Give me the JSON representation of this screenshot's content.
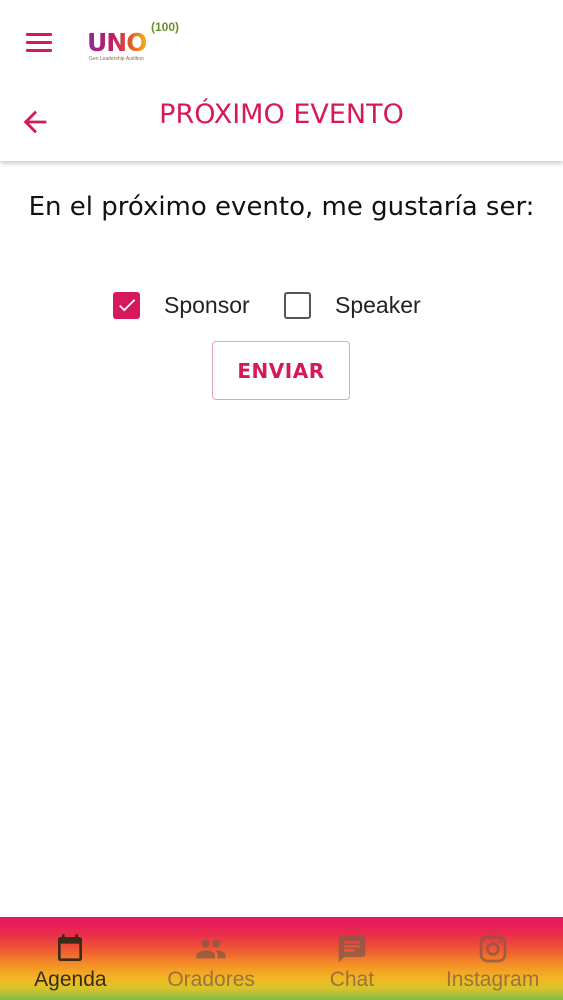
{
  "app": {
    "logo_text": "UNO",
    "logo_superscript": "(100)",
    "logo_tagline": "Geo Leadership Audition"
  },
  "header": {
    "title": "PRÓXIMO EVENTO"
  },
  "form": {
    "question": "En el próximo evento, me gustaría ser:",
    "options": [
      {
        "label": "Sponsor",
        "checked": true
      },
      {
        "label": "Speaker",
        "checked": false
      }
    ],
    "submit_label": "ENVIAR"
  },
  "bottom_nav": {
    "items": [
      {
        "label": "Agenda",
        "icon": "calendar-icon",
        "active": true
      },
      {
        "label": "Oradores",
        "icon": "people-icon",
        "active": false
      },
      {
        "label": "Chat",
        "icon": "chat-icon",
        "active": false
      },
      {
        "label": "Instagram",
        "icon": "instagram-icon",
        "active": false
      }
    ]
  },
  "colors": {
    "accent": "#d6185c",
    "nav_gradient_top": "#e4165f",
    "nav_gradient_mid": "#f39225",
    "nav_gradient_bottom": "#7fbc4a"
  }
}
